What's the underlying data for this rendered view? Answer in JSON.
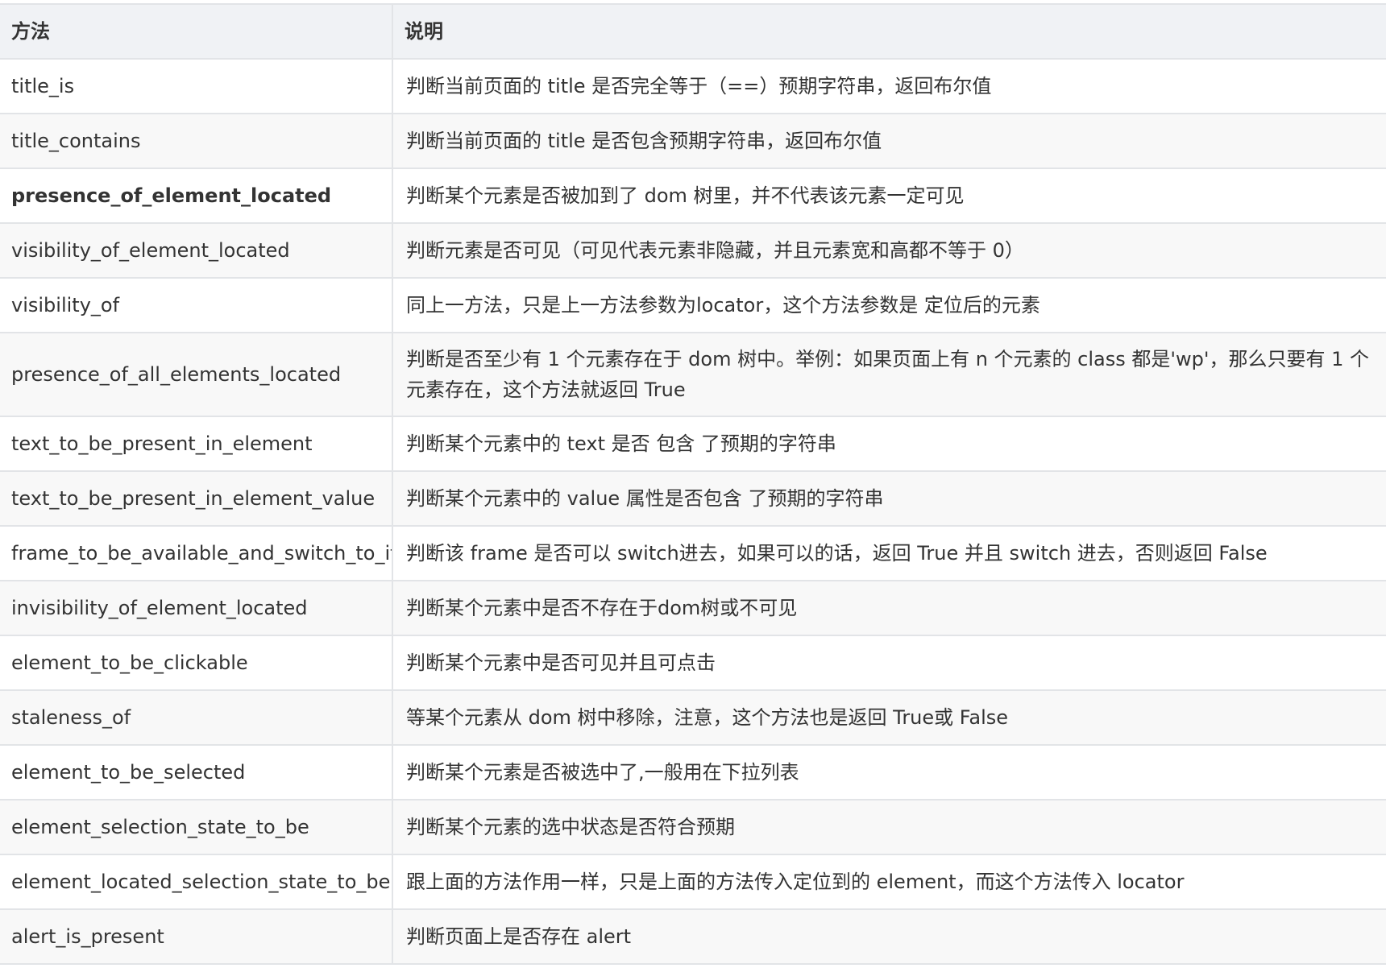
{
  "table": {
    "headers": [
      "方法",
      "说明"
    ],
    "rows": [
      {
        "method": "title_is",
        "desc": "判断当前页面的 title 是否完全等于（==）预期字符串，返回布尔值"
      },
      {
        "method": "title_contains",
        "desc": "判断当前页面的 title 是否包含预期字符串，返回布尔值"
      },
      {
        "method": "presence_of_element_located",
        "desc": "判断某个元素是否被加到了 dom 树里，并不代表该元素一定可见"
      },
      {
        "method": "visibility_of_element_located",
        "desc": "判断元素是否可见（可见代表元素非隐藏，并且元素宽和高都不等于 0）"
      },
      {
        "method": "visibility_of",
        "desc": "同上一方法，只是上一方法参数为locator，这个方法参数是 定位后的元素"
      },
      {
        "method": "presence_of_all_elements_located",
        "desc": "判断是否至少有 1 个元素存在于 dom 树中。举例：如果页面上有 n 个元素的 class 都是'wp'，那么只要有 1 个元素存在，这个方法就返回 True"
      },
      {
        "method": "text_to_be_present_in_element",
        "desc": "判断某个元素中的 text 是否 包含 了预期的字符串"
      },
      {
        "method": "text_to_be_present_in_element_value",
        "desc": "判断某个元素中的 value 属性是否包含 了预期的字符串"
      },
      {
        "method": "frame_to_be_available_and_switch_to_it",
        "desc": "判断该 frame 是否可以 switch进去，如果可以的话，返回 True 并且 switch 进去，否则返回 False"
      },
      {
        "method": "invisibility_of_element_located",
        "desc": "判断某个元素中是否不存在于dom树或不可见"
      },
      {
        "method": "element_to_be_clickable",
        "desc": "判断某个元素中是否可见并且可点击"
      },
      {
        "method": "staleness_of",
        "desc": "等某个元素从 dom 树中移除，注意，这个方法也是返回 True或 False"
      },
      {
        "method": "element_to_be_selected",
        "desc": "判断某个元素是否被选中了,一般用在下拉列表"
      },
      {
        "method": "element_selection_state_to_be",
        "desc": "判断某个元素的选中状态是否符合预期"
      },
      {
        "method": "element_located_selection_state_to_be",
        "desc": "跟上面的方法作用一样，只是上面的方法传入定位到的 element，而这个方法传入 locator"
      },
      {
        "method": "alert_is_present",
        "desc": "判断页面上是否存在 alert"
      }
    ]
  }
}
